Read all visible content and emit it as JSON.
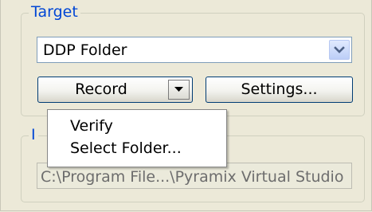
{
  "target_group": {
    "label": "Target",
    "format_select": {
      "value": "DDP Folder",
      "dropdown_icon": "chevron-down-icon"
    },
    "record_button": {
      "label": "Record",
      "arrow_icon": "caret-down-icon"
    },
    "settings_button": {
      "label": "Settings..."
    }
  },
  "info_group": {
    "label": "I",
    "path_value": "C:\\Program File...\\Pyramix Virtual Studio"
  },
  "record_menu": {
    "items": [
      {
        "label": "Verify"
      },
      {
        "label": "Select Folder..."
      }
    ]
  },
  "colors": {
    "panel_bg": "#ece9d8",
    "group_label": "#0046d5",
    "button_border": "#003c74"
  }
}
